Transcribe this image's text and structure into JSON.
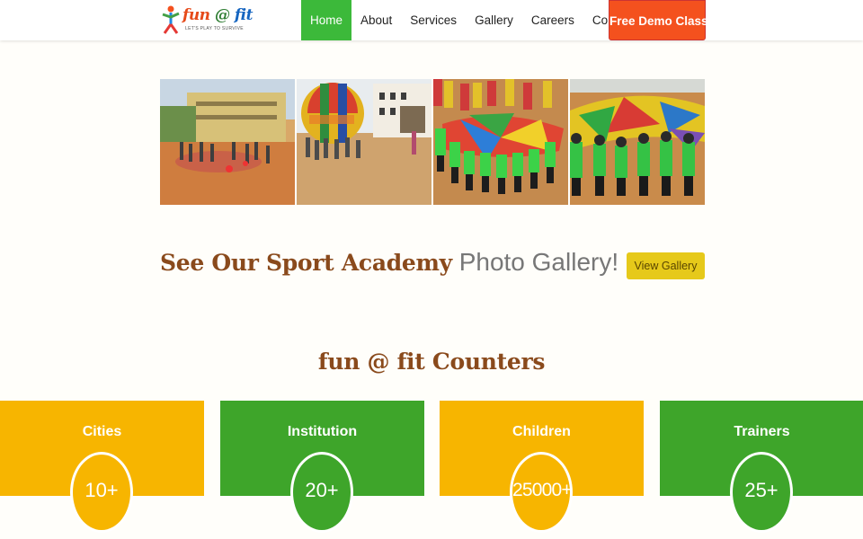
{
  "logo": {
    "name_part1": "fun ",
    "name_part2": "@",
    "name_part3": " fit",
    "tagline": "LET'S PLAY TO SURVIVE"
  },
  "nav": {
    "items": [
      {
        "label": "Home"
      },
      {
        "label": "About"
      },
      {
        "label": "Services"
      },
      {
        "label": "Gallery"
      },
      {
        "label": "Careers"
      },
      {
        "label": "Contact"
      }
    ],
    "cta_label": "Free Demo Class"
  },
  "gallery": {
    "headline_strong": "See Our Sport Academy",
    "headline_light": " Photo Gallery!",
    "button_label": "View Gallery"
  },
  "counters": {
    "title": "fun @ fit Counters",
    "items": [
      {
        "label": "Cities",
        "value": "10+",
        "color": "#f7b500"
      },
      {
        "label": "Institution",
        "value": "20+",
        "color": "#3ea52a"
      },
      {
        "label": "Children",
        "value": "25000+",
        "color": "#f7b500"
      },
      {
        "label": "Trainers",
        "value": "25+",
        "color": "#3ea52a"
      }
    ]
  },
  "colors": {
    "nav_active": "#3cb93a",
    "cta": "#f4511e",
    "headline": "#8a4a1c",
    "button": "#e6c91a"
  }
}
